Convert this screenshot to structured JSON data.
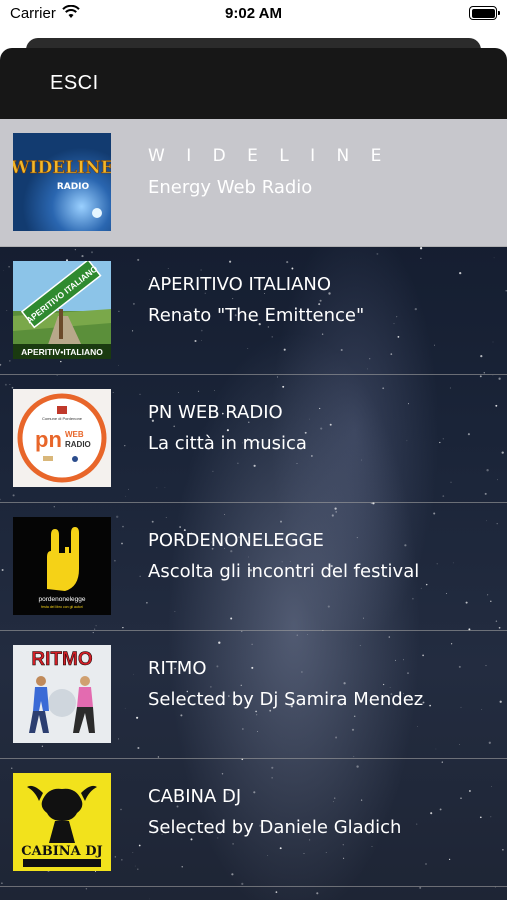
{
  "status_bar": {
    "carrier": "Carrier",
    "time": "9:02 AM"
  },
  "nav": {
    "exit_label": "ESCI"
  },
  "stations": [
    {
      "title": "W I D E L I N E",
      "subtitle": "Energy Web Radio",
      "selected": true,
      "logo_text": "WIDELINE",
      "logo_sub": "RADIO"
    },
    {
      "title": "APERITIVO ITALIANO",
      "subtitle": "Renato \"The Emittence\"",
      "selected": false,
      "logo_text": "APERITIVO ITALIANO",
      "logo_sub": "APERITIV•ITALIANO"
    },
    {
      "title": "PN WEB RADIO",
      "subtitle": "La città in musica",
      "selected": false,
      "logo_text": "pn",
      "logo_sub": "WEB RADIO"
    },
    {
      "title": "PORDENONELEGGE",
      "subtitle": "Ascolta gli incontri del festival",
      "selected": false,
      "logo_text": "pordenonelegge",
      "logo_sub": ""
    },
    {
      "title": "RITMO",
      "subtitle": "Selected by Dj Samira Mendez",
      "selected": false,
      "logo_text": "RITMO",
      "logo_sub": ""
    },
    {
      "title": "CABINA DJ",
      "subtitle": "Selected by Daniele Gladich",
      "selected": false,
      "logo_text": "CABINA DJ",
      "logo_sub": ""
    }
  ],
  "colors": {
    "selected_row": "#c7c7cc",
    "nav_bg": "#171717",
    "separator": "#a0a0a0"
  }
}
